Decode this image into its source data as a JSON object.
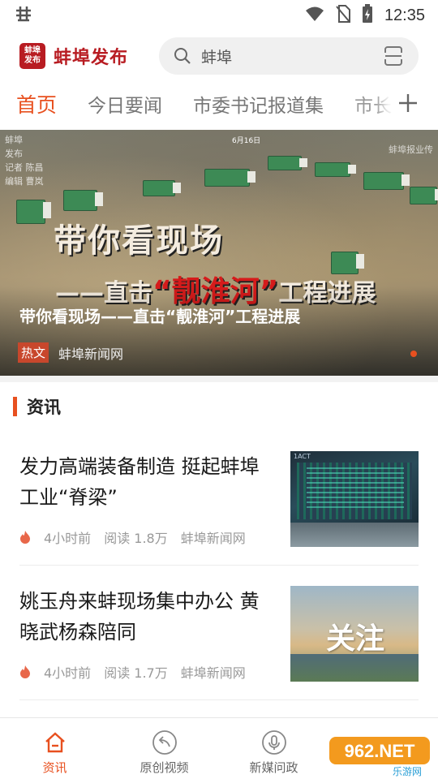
{
  "status_bar": {
    "left_icon": "bug-icon",
    "time": "12:35",
    "icons": [
      "wifi-icon",
      "no-sim-icon",
      "battery-charging-icon"
    ]
  },
  "header": {
    "logo_badge": [
      "蚌埠",
      "发布"
    ],
    "logo_text": "蚌埠发布",
    "search_value": "蚌埠",
    "search_icon": "search-icon",
    "scan_icon": "scan-icon"
  },
  "tabs": [
    {
      "label": "首页",
      "active": true
    },
    {
      "label": "今日要闻",
      "active": false
    },
    {
      "label": "市委书记报道集",
      "active": false
    },
    {
      "label": "市长",
      "active": false
    }
  ],
  "banner": {
    "corner_text": [
      "蚌埠",
      "发布",
      "记者 陈昌",
      "编辑 曹岚"
    ],
    "date": "6月16日",
    "watermark": "蚌埠报业传",
    "overlay_title": "带你看现场",
    "overlay_sub_prefix": "——直击",
    "overlay_sub_highlight": "“靓淮河”",
    "overlay_sub_suffix": "工程进展",
    "caption": "带你看现场——直击“靓淮河”工程进展",
    "badge": "热文",
    "source": "蚌埠新闻网"
  },
  "section": {
    "title": "资讯"
  },
  "news": [
    {
      "title": "发力高端装备制造 挺起蚌埠工业“脊梁”",
      "time": "4小时前",
      "reads": "阅读 1.8万",
      "source": "蚌埠新闻网",
      "thumb_label": "1ACT"
    },
    {
      "title": "姚玉舟来蚌现场集中办公 黄晓武杨森陪同",
      "time": "4小时前",
      "reads": "阅读 1.7万",
      "source": "蚌埠新闻网",
      "thumb_label": "关注"
    }
  ],
  "bottom_nav": [
    {
      "label": "资讯",
      "icon": "home-icon",
      "active": true
    },
    {
      "label": "原创视频",
      "icon": "share-back-icon",
      "active": false
    },
    {
      "label": "新媒问政",
      "icon": "microphone-icon",
      "active": false
    }
  ],
  "watermark": {
    "brand": "962.NET",
    "subtitle": "乐游网"
  },
  "colors": {
    "accent": "#e8501f",
    "brand_red": "#b81c22"
  }
}
